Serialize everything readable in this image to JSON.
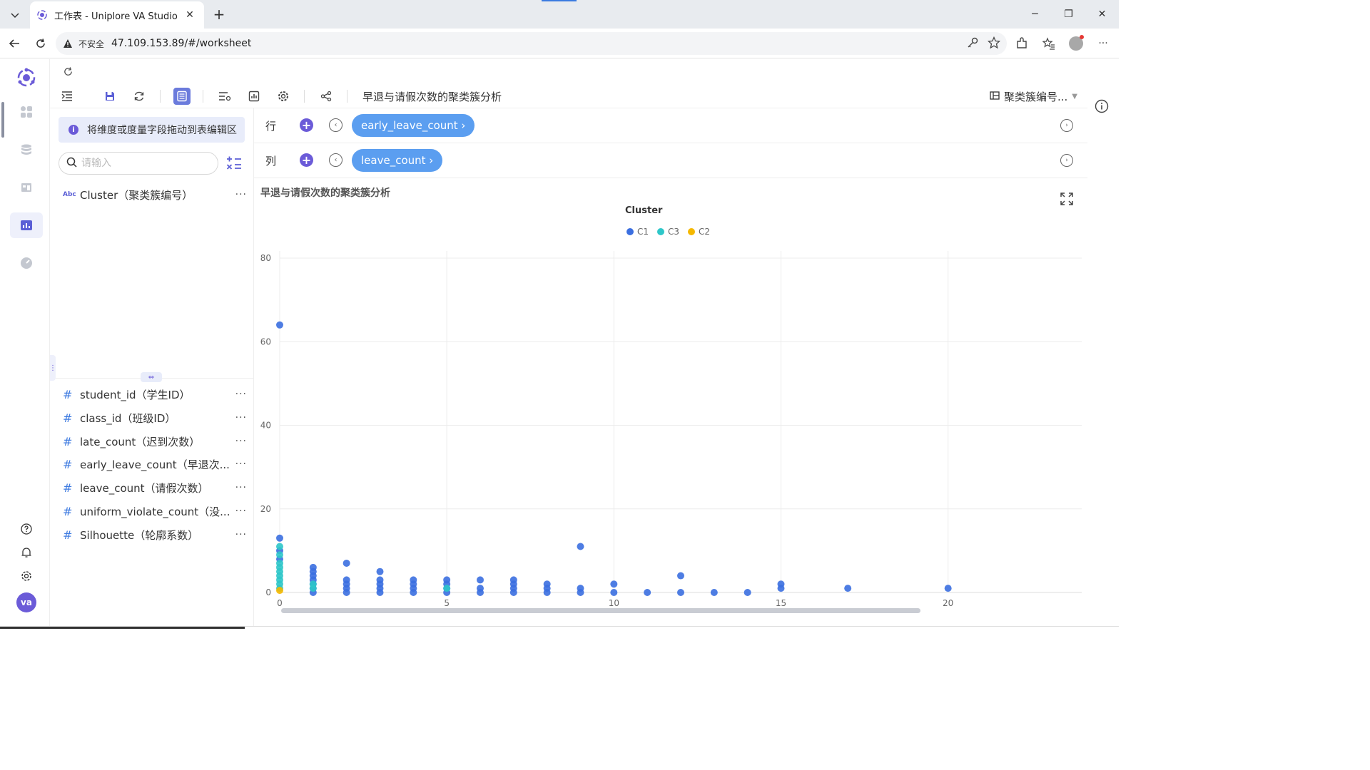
{
  "browser": {
    "tab_title": "工作表 - Uniplore VA Studio",
    "insecure_label": "不安全",
    "url": "47.109.153.89/#/worksheet"
  },
  "toolbar": {
    "worksheet_title": "早退与请假次数的聚类簇分析",
    "right_dropdown": "聚类簇编号..."
  },
  "panel": {
    "drag_hint": "将维度或度量字段拖动到表编辑区",
    "search_placeholder": "请输入",
    "dimensions": [
      {
        "type": "Abc",
        "name": "Cluster（聚类簇编号）"
      }
    ],
    "measures": [
      {
        "type": "#",
        "name": "student_id（学生ID）"
      },
      {
        "type": "#",
        "name": "class_id（班级ID）"
      },
      {
        "type": "#",
        "name": "late_count（迟到次数）"
      },
      {
        "type": "#",
        "name": "early_leave_count（早退次..."
      },
      {
        "type": "#",
        "name": "leave_count（请假次数）"
      },
      {
        "type": "#",
        "name": "uniform_violate_count（没..."
      },
      {
        "type": "#",
        "name": "Silhouette（轮廓系数）"
      }
    ],
    "more_label": "···"
  },
  "shelves": {
    "rows_label": "行",
    "rows_pill": "early_leave_count ›",
    "cols_label": "列",
    "cols_pill": "leave_count ›"
  },
  "rail": {
    "avatar_text": "va"
  },
  "colors": {
    "accent": "#6b5bd8",
    "pill": "#5b9ef0",
    "C1": "#3b6fe0",
    "C3": "#2ec7c9",
    "C2": "#f5b800"
  },
  "chart_data": {
    "type": "scatter",
    "title": "早退与请假次数的聚类簇分析",
    "legend_title": "Cluster",
    "legend": [
      "C1",
      "C3",
      "C2"
    ],
    "legend_placement": "top-center",
    "xlabel": "",
    "ylabel": "",
    "xlim": [
      0,
      24
    ],
    "ylim": [
      0,
      80
    ],
    "x_ticks": [
      0,
      5,
      10,
      15,
      20
    ],
    "y_ticks": [
      0,
      20,
      40,
      60,
      80
    ],
    "grid": true,
    "series": [
      {
        "name": "C1",
        "color": "#3b6fe0",
        "points": [
          [
            0,
            64
          ],
          [
            0,
            13
          ],
          [
            0,
            10
          ],
          [
            0,
            8
          ],
          [
            1,
            6
          ],
          [
            1,
            5
          ],
          [
            1,
            4
          ],
          [
            1,
            3
          ],
          [
            1,
            2
          ],
          [
            1,
            1
          ],
          [
            1,
            0
          ],
          [
            2,
            7
          ],
          [
            2,
            3
          ],
          [
            2,
            2
          ],
          [
            2,
            1
          ],
          [
            2,
            0
          ],
          [
            3,
            5
          ],
          [
            3,
            3
          ],
          [
            3,
            2
          ],
          [
            3,
            1
          ],
          [
            3,
            0
          ],
          [
            4,
            3
          ],
          [
            4,
            2
          ],
          [
            4,
            1
          ],
          [
            4,
            0
          ],
          [
            5,
            3
          ],
          [
            5,
            2
          ],
          [
            5,
            1
          ],
          [
            5,
            0
          ],
          [
            6,
            3
          ],
          [
            6,
            1
          ],
          [
            6,
            0
          ],
          [
            7,
            3
          ],
          [
            7,
            2
          ],
          [
            7,
            1
          ],
          [
            7,
            0
          ],
          [
            8,
            2
          ],
          [
            8,
            1
          ],
          [
            8,
            0
          ],
          [
            9,
            11
          ],
          [
            9,
            1
          ],
          [
            9,
            0
          ],
          [
            10,
            2
          ],
          [
            10,
            0
          ],
          [
            11,
            0
          ],
          [
            12,
            4
          ],
          [
            12,
            0
          ],
          [
            13,
            0
          ],
          [
            14,
            0
          ],
          [
            15,
            2
          ],
          [
            15,
            1
          ],
          [
            17,
            1
          ],
          [
            20,
            1
          ]
        ]
      },
      {
        "name": "C3",
        "color": "#2ec7c9",
        "points": [
          [
            0,
            11
          ],
          [
            0,
            9
          ],
          [
            0,
            7
          ],
          [
            0,
            6
          ],
          [
            0,
            5
          ],
          [
            0,
            4
          ],
          [
            0,
            3
          ],
          [
            0,
            2
          ],
          [
            0,
            1
          ],
          [
            1,
            2
          ],
          [
            1,
            1
          ],
          [
            5,
            1
          ]
        ]
      },
      {
        "name": "C2",
        "color": "#f5b800",
        "points": [
          [
            0,
            0.5
          ]
        ]
      }
    ]
  }
}
